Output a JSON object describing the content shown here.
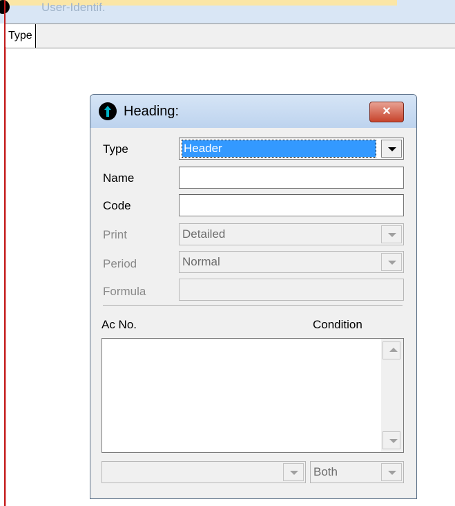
{
  "background": {
    "window_title": "User-Identif.",
    "header_cell": "Type"
  },
  "dialog": {
    "title": "Heading:",
    "close_glyph": "✕",
    "fields": {
      "type": {
        "label": "Type",
        "value": "Header"
      },
      "name": {
        "label": "Name",
        "value": ""
      },
      "code": {
        "label": "Code",
        "value": ""
      },
      "print": {
        "label": "Print",
        "value": "Detailed"
      },
      "period": {
        "label": "Period",
        "value": "Normal"
      },
      "formula": {
        "label": "Formula",
        "value": ""
      }
    },
    "list": {
      "col_acno": "Ac No.",
      "col_condition": "Condition"
    },
    "bottom": {
      "account_combo_value": "",
      "condition_combo_value": "Both"
    }
  },
  "colors": {
    "titlebar": "#d9e6f5",
    "accent_red": "#c21a1a",
    "selection": "#3399ff",
    "close_button": "#c7432b"
  },
  "icons": [
    "info-arrow-icon",
    "close-icon",
    "chevron-down-icon",
    "scroll-up-icon",
    "scroll-down-icon"
  ]
}
